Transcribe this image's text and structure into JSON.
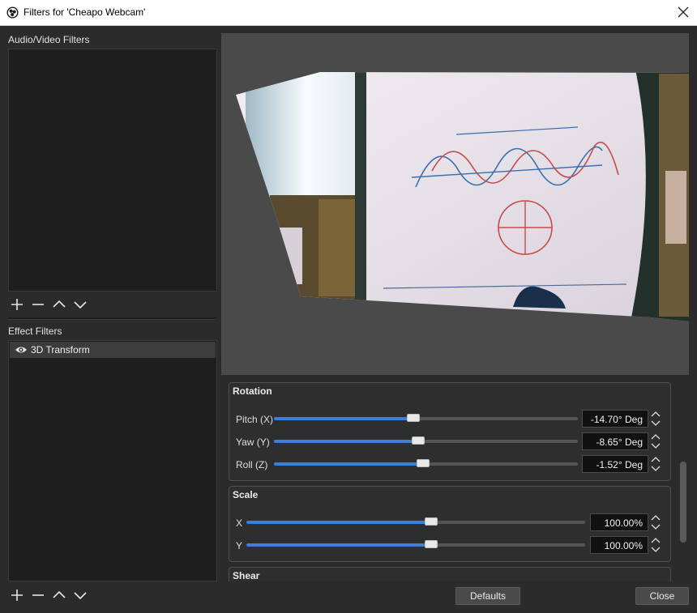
{
  "window": {
    "title": "Filters for 'Cheapo Webcam'",
    "app_icon": "obs-icon",
    "close_icon": "close-icon"
  },
  "audio_video_filters": {
    "label": "Audio/Video Filters",
    "items": []
  },
  "effect_filters": {
    "label": "Effect Filters",
    "items": [
      {
        "name": "3D Transform",
        "visible": true,
        "icon": "eye-icon"
      }
    ]
  },
  "toolbar": {
    "add_icon": "plus-icon",
    "remove_icon": "minus-icon",
    "up_icon": "chevron-up-icon",
    "down_icon": "chevron-down-icon"
  },
  "preview": {
    "description_icon": "webcam-preview"
  },
  "rotation": {
    "title": "Rotation",
    "pitch": {
      "label": "Pitch (X)",
      "value": "-14.70° Deg",
      "fraction": 0.46
    },
    "yaw": {
      "label": "Yaw (Y)",
      "value": "-8.65° Deg",
      "fraction": 0.47
    },
    "roll": {
      "label": "Roll (Z)",
      "value": "-1.52° Deg",
      "fraction": 0.49
    }
  },
  "scale": {
    "title": "Scale",
    "x": {
      "label": "X",
      "value": "100.00%",
      "fraction": 0.54
    },
    "y": {
      "label": "Y",
      "value": "100.00%",
      "fraction": 0.54
    }
  },
  "shear": {
    "title": "Shear"
  },
  "buttons": {
    "defaults": "Defaults",
    "close": "Close"
  },
  "colors": {
    "accent": "#3a7fd8",
    "background": "#2b2b2b",
    "panel": "#1e1e1e"
  }
}
